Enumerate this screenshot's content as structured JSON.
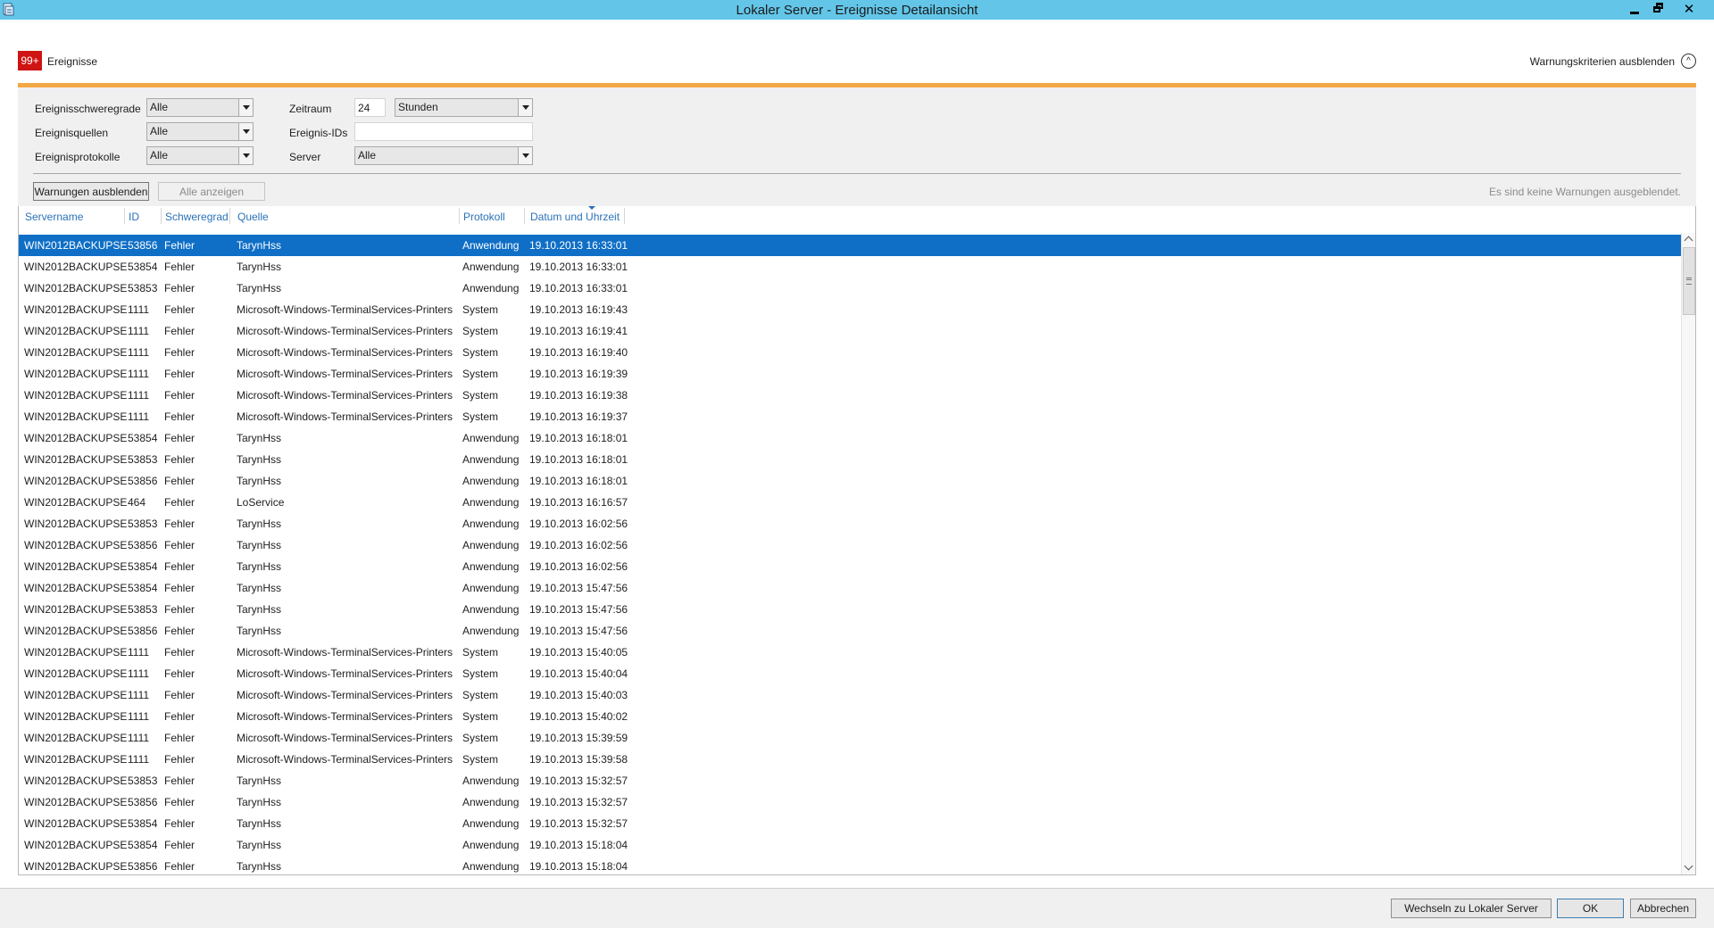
{
  "window": {
    "title": "Lokaler Server - Ereignisse Detailansicht",
    "app_icon": "server-manager-icon",
    "controls": {
      "minimize": "minimize-icon",
      "restore": "restore-icon",
      "close": "✕"
    }
  },
  "header": {
    "badge": "99+",
    "label": "Ereignisse",
    "hide_criteria": "Warnungskriterien ausblenden",
    "collapse_icon": "^"
  },
  "filters": {
    "severity_label": "Ereignisschweregrade",
    "severity_value": "Alle",
    "sources_label": "Ereignisquellen",
    "sources_value": "Alle",
    "logs_label": "Ereignisprotokolle",
    "logs_value": "Alle",
    "period_label": "Zeitraum",
    "period_value": "24",
    "period_unit": "Stunden",
    "event_ids_label": "Ereignis-IDs",
    "event_ids_value": "",
    "server_label": "Server",
    "server_value": "Alle"
  },
  "actions": {
    "hide_warnings": "Warnungen ausblenden",
    "show_all": "Alle anzeigen",
    "status": "Es sind keine Warnungen ausgeblendet."
  },
  "columns": [
    "Servername",
    "ID",
    "Schweregrad",
    "Quelle",
    "Protokoll",
    "Datum und Uhrzeit"
  ],
  "rows": [
    {
      "server": "WIN2012BACKUPSE",
      "id": "53856",
      "severity": "Fehler",
      "source": "TarynHss",
      "log": "Anwendung",
      "datetime": "19.10.2013 16:33:01"
    },
    {
      "server": "WIN2012BACKUPSE",
      "id": "53854",
      "severity": "Fehler",
      "source": "TarynHss",
      "log": "Anwendung",
      "datetime": "19.10.2013 16:33:01"
    },
    {
      "server": "WIN2012BACKUPSE",
      "id": "53853",
      "severity": "Fehler",
      "source": "TarynHss",
      "log": "Anwendung",
      "datetime": "19.10.2013 16:33:01"
    },
    {
      "server": "WIN2012BACKUPSE",
      "id": "1111",
      "severity": "Fehler",
      "source": "Microsoft-Windows-TerminalServices-Printers",
      "log": "System",
      "datetime": "19.10.2013 16:19:43"
    },
    {
      "server": "WIN2012BACKUPSE",
      "id": "1111",
      "severity": "Fehler",
      "source": "Microsoft-Windows-TerminalServices-Printers",
      "log": "System",
      "datetime": "19.10.2013 16:19:41"
    },
    {
      "server": "WIN2012BACKUPSE",
      "id": "1111",
      "severity": "Fehler",
      "source": "Microsoft-Windows-TerminalServices-Printers",
      "log": "System",
      "datetime": "19.10.2013 16:19:40"
    },
    {
      "server": "WIN2012BACKUPSE",
      "id": "1111",
      "severity": "Fehler",
      "source": "Microsoft-Windows-TerminalServices-Printers",
      "log": "System",
      "datetime": "19.10.2013 16:19:39"
    },
    {
      "server": "WIN2012BACKUPSE",
      "id": "1111",
      "severity": "Fehler",
      "source": "Microsoft-Windows-TerminalServices-Printers",
      "log": "System",
      "datetime": "19.10.2013 16:19:38"
    },
    {
      "server": "WIN2012BACKUPSE",
      "id": "1111",
      "severity": "Fehler",
      "source": "Microsoft-Windows-TerminalServices-Printers",
      "log": "System",
      "datetime": "19.10.2013 16:19:37"
    },
    {
      "server": "WIN2012BACKUPSE",
      "id": "53854",
      "severity": "Fehler",
      "source": "TarynHss",
      "log": "Anwendung",
      "datetime": "19.10.2013 16:18:01"
    },
    {
      "server": "WIN2012BACKUPSE",
      "id": "53853",
      "severity": "Fehler",
      "source": "TarynHss",
      "log": "Anwendung",
      "datetime": "19.10.2013 16:18:01"
    },
    {
      "server": "WIN2012BACKUPSE",
      "id": "53856",
      "severity": "Fehler",
      "source": "TarynHss",
      "log": "Anwendung",
      "datetime": "19.10.2013 16:18:01"
    },
    {
      "server": "WIN2012BACKUPSE",
      "id": "464",
      "severity": "Fehler",
      "source": "LoService",
      "log": "Anwendung",
      "datetime": "19.10.2013 16:16:57"
    },
    {
      "server": "WIN2012BACKUPSE",
      "id": "53853",
      "severity": "Fehler",
      "source": "TarynHss",
      "log": "Anwendung",
      "datetime": "19.10.2013 16:02:56"
    },
    {
      "server": "WIN2012BACKUPSE",
      "id": "53856",
      "severity": "Fehler",
      "source": "TarynHss",
      "log": "Anwendung",
      "datetime": "19.10.2013 16:02:56"
    },
    {
      "server": "WIN2012BACKUPSE",
      "id": "53854",
      "severity": "Fehler",
      "source": "TarynHss",
      "log": "Anwendung",
      "datetime": "19.10.2013 16:02:56"
    },
    {
      "server": "WIN2012BACKUPSE",
      "id": "53854",
      "severity": "Fehler",
      "source": "TarynHss",
      "log": "Anwendung",
      "datetime": "19.10.2013 15:47:56"
    },
    {
      "server": "WIN2012BACKUPSE",
      "id": "53853",
      "severity": "Fehler",
      "source": "TarynHss",
      "log": "Anwendung",
      "datetime": "19.10.2013 15:47:56"
    },
    {
      "server": "WIN2012BACKUPSE",
      "id": "53856",
      "severity": "Fehler",
      "source": "TarynHss",
      "log": "Anwendung",
      "datetime": "19.10.2013 15:47:56"
    },
    {
      "server": "WIN2012BACKUPSE",
      "id": "1111",
      "severity": "Fehler",
      "source": "Microsoft-Windows-TerminalServices-Printers",
      "log": "System",
      "datetime": "19.10.2013 15:40:05"
    },
    {
      "server": "WIN2012BACKUPSE",
      "id": "1111",
      "severity": "Fehler",
      "source": "Microsoft-Windows-TerminalServices-Printers",
      "log": "System",
      "datetime": "19.10.2013 15:40:04"
    },
    {
      "server": "WIN2012BACKUPSE",
      "id": "1111",
      "severity": "Fehler",
      "source": "Microsoft-Windows-TerminalServices-Printers",
      "log": "System",
      "datetime": "19.10.2013 15:40:03"
    },
    {
      "server": "WIN2012BACKUPSE",
      "id": "1111",
      "severity": "Fehler",
      "source": "Microsoft-Windows-TerminalServices-Printers",
      "log": "System",
      "datetime": "19.10.2013 15:40:02"
    },
    {
      "server": "WIN2012BACKUPSE",
      "id": "1111",
      "severity": "Fehler",
      "source": "Microsoft-Windows-TerminalServices-Printers",
      "log": "System",
      "datetime": "19.10.2013 15:39:59"
    },
    {
      "server": "WIN2012BACKUPSE",
      "id": "1111",
      "severity": "Fehler",
      "source": "Microsoft-Windows-TerminalServices-Printers",
      "log": "System",
      "datetime": "19.10.2013 15:39:58"
    },
    {
      "server": "WIN2012BACKUPSE",
      "id": "53853",
      "severity": "Fehler",
      "source": "TarynHss",
      "log": "Anwendung",
      "datetime": "19.10.2013 15:32:57"
    },
    {
      "server": "WIN2012BACKUPSE",
      "id": "53856",
      "severity": "Fehler",
      "source": "TarynHss",
      "log": "Anwendung",
      "datetime": "19.10.2013 15:32:57"
    },
    {
      "server": "WIN2012BACKUPSE",
      "id": "53854",
      "severity": "Fehler",
      "source": "TarynHss",
      "log": "Anwendung",
      "datetime": "19.10.2013 15:32:57"
    },
    {
      "server": "WIN2012BACKUPSE",
      "id": "53854",
      "severity": "Fehler",
      "source": "TarynHss",
      "log": "Anwendung",
      "datetime": "19.10.2013 15:18:04"
    },
    {
      "server": "WIN2012BACKUPSE",
      "id": "53856",
      "severity": "Fehler",
      "source": "TarynHss",
      "log": "Anwendung",
      "datetime": "19.10.2013 15:18:04"
    }
  ],
  "selected_row": 0,
  "footer": {
    "switch_label": "Wechseln zu Lokaler Server",
    "ok_label": "OK",
    "cancel_label": "Abbrechen"
  },
  "colors": {
    "titlebar": "#63c6e9",
    "accent_bar": "#f3a845",
    "badge": "#cf1414",
    "selection": "#0f6fc6",
    "column_header_text": "#2a72b8"
  }
}
